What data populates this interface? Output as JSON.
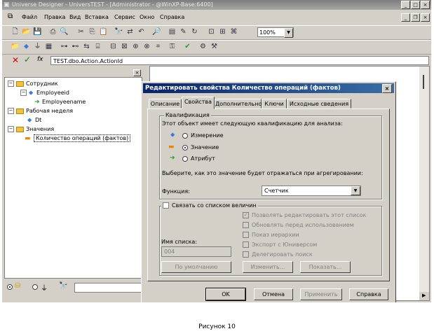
{
  "window": {
    "title": "Universe Designer - UniversTEST - [Administrator - @WinXP-Base:6400]"
  },
  "menu": {
    "items": [
      "Файл",
      "Правка",
      "Вид",
      "Вставка",
      "Сервис",
      "Окно",
      "Справка"
    ]
  },
  "toolbar": {
    "zoom": "100%"
  },
  "formula_bar": {
    "value": "TEST.dbo.Action.ActionId"
  },
  "tree": {
    "nodes": [
      {
        "label": "Сотрудник"
      },
      {
        "label": "Employeeid"
      },
      {
        "label": "Employeename"
      },
      {
        "label": "Рабочая неделя"
      },
      {
        "label": "Dt"
      },
      {
        "label": "Значения"
      },
      {
        "label": "Количество операций (фактов)"
      }
    ]
  },
  "dialog": {
    "title": "Редактировать свойства Количество операций (фактов)",
    "tabs": [
      "Описание",
      "Свойства",
      "Дополнительно",
      "Ключи",
      "Исходные сведения"
    ],
    "active_tab": "Свойства",
    "qualification": {
      "legend": "Квалификация",
      "prompt": "Этот объект имеет следующую квалификацию для анализа:",
      "options": [
        "Измерение",
        "Значение",
        "Атрибут"
      ],
      "selected": "Значение",
      "aggregation_prompt": "Выберите, как это значение будет отражаться при агрегировании:",
      "function_label": "Функция:",
      "function_value": "Счетчик"
    },
    "list": {
      "link_label": "Связать со списком величин",
      "options": [
        {
          "label": "Позволять редактировать этот список",
          "checked": true
        },
        {
          "label": "Обновлять перед использованием",
          "checked": false
        },
        {
          "label": "Показ иерархии",
          "checked": false
        },
        {
          "label": "Экспорт с Юниверсом",
          "checked": false
        },
        {
          "label": "Делегировать поиск",
          "checked": false
        }
      ],
      "name_label": "Имя списка:",
      "name_value": "004",
      "default_button": "По умолчанию",
      "edit_button": "Изменить...",
      "show_button": "Показать..."
    },
    "buttons": {
      "ok": "OK",
      "cancel": "Отмена",
      "apply": "Применить",
      "help": "Справка"
    }
  },
  "caption": "Рисунок 10"
}
